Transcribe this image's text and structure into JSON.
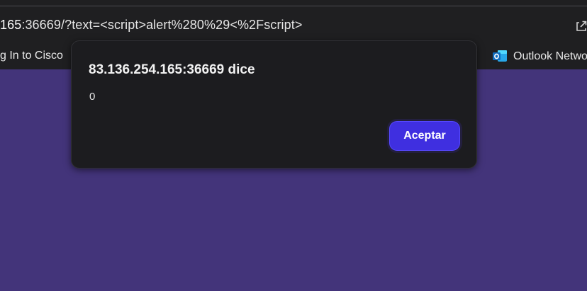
{
  "browser": {
    "address_bar": {
      "url_host_partial": "165",
      "url_rest": ":36669/?text=<script>alert%280%29<%2Fscript>"
    },
    "bookmarks": [
      {
        "label": "g In to Cisco"
      },
      {
        "label": "Outlook Netwo",
        "icon": "outlook-icon"
      }
    ]
  },
  "dialog": {
    "title": "83.136.254.165:36669 dice",
    "message": "0",
    "accept_label": "Aceptar"
  },
  "colors": {
    "page_background": "#43347a",
    "browser_chrome": "#1f1f21",
    "dialog_background": "#1c1c1f",
    "accent_button": "#3f2fe0",
    "outlook_blue": "#0f6cbd"
  }
}
